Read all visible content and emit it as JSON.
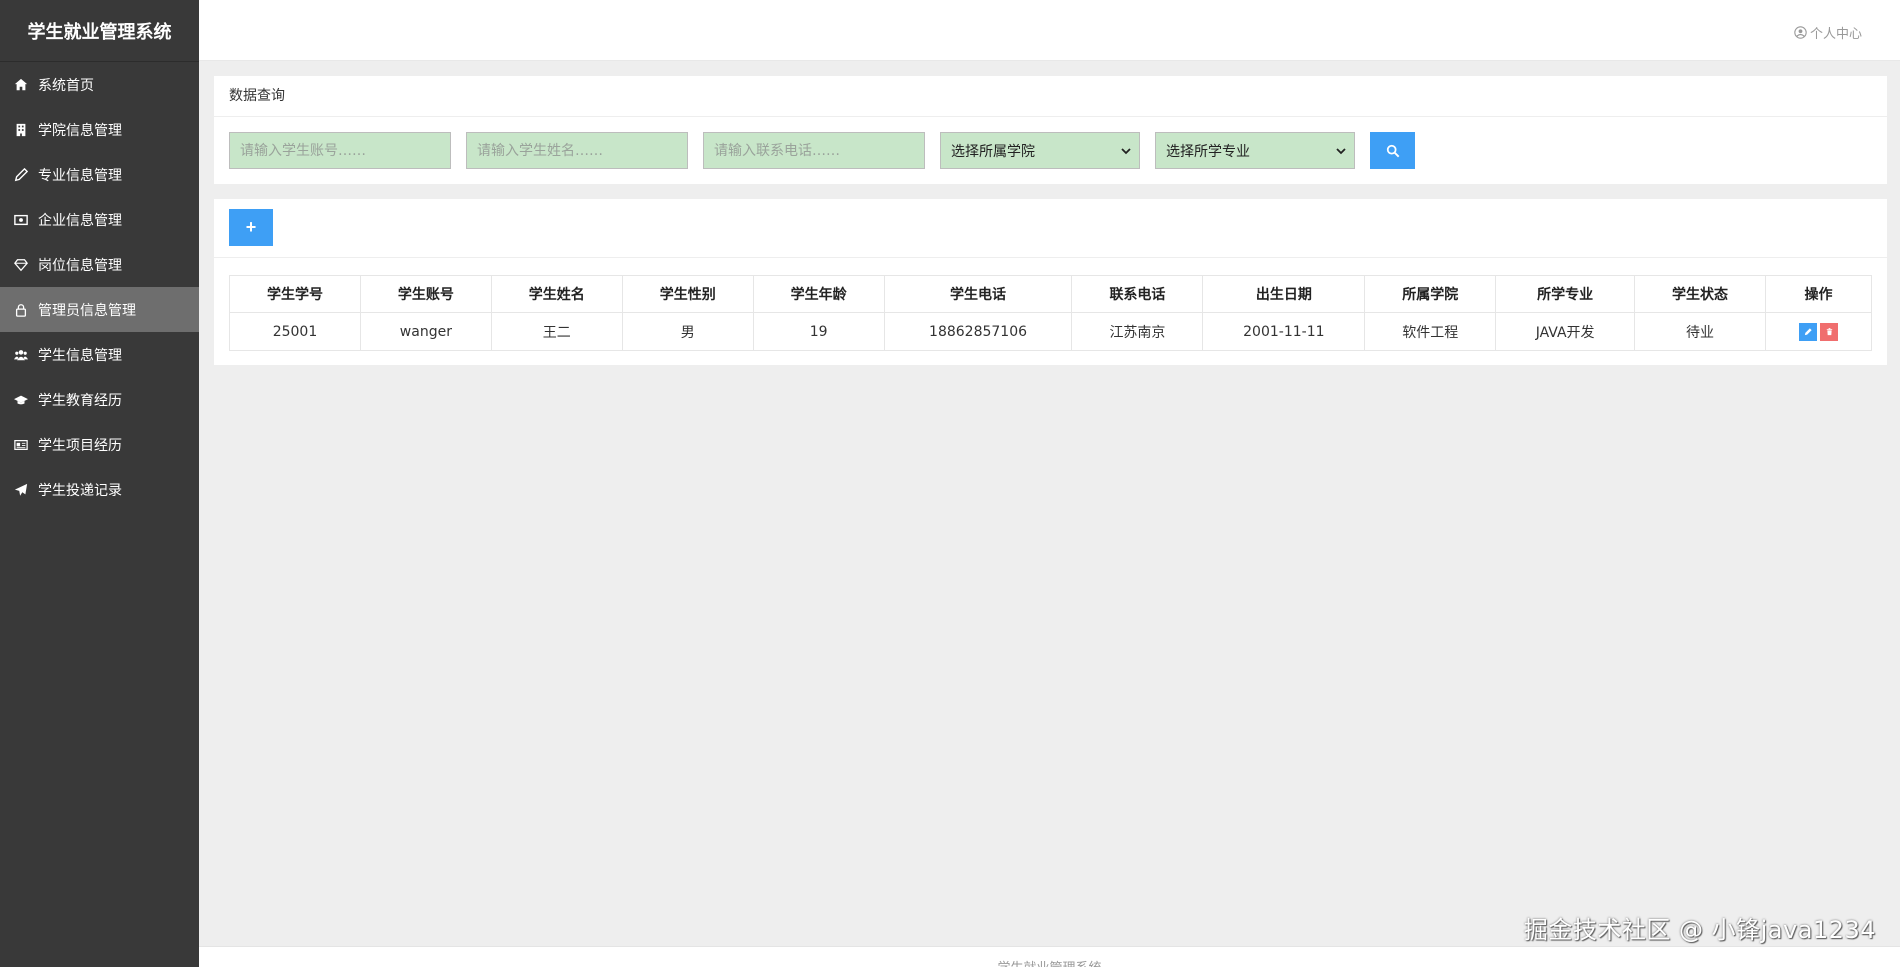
{
  "app": {
    "title": "学生就业管理系统"
  },
  "sidebar": {
    "items": [
      {
        "label": "系统首页",
        "icon": "home-icon"
      },
      {
        "label": "学院信息管理",
        "icon": "building-icon"
      },
      {
        "label": "专业信息管理",
        "icon": "pen-icon"
      },
      {
        "label": "企业信息管理",
        "icon": "money-icon"
      },
      {
        "label": "岗位信息管理",
        "icon": "diamond-icon"
      },
      {
        "label": "管理员信息管理",
        "icon": "lock-icon",
        "active": true
      },
      {
        "label": "学生信息管理",
        "icon": "users-icon"
      },
      {
        "label": "学生教育经历",
        "icon": "graduation-cap-icon"
      },
      {
        "label": "学生项目经历",
        "icon": "id-card-icon"
      },
      {
        "label": "学生投递记录",
        "icon": "paper-plane-icon"
      }
    ]
  },
  "header": {
    "user_center": "个人中心"
  },
  "search": {
    "title": "数据查询",
    "account_placeholder": "请输入学生账号……",
    "name_placeholder": "请输入学生姓名……",
    "phone_placeholder": "请输入联系电话……",
    "college_select": "选择所属学院",
    "major_select": "选择所学专业"
  },
  "toolbar": {
    "add_label": "+"
  },
  "table": {
    "headers": [
      "学生学号",
      "学生账号",
      "学生姓名",
      "学生性别",
      "学生年龄",
      "学生电话",
      "联系电话",
      "出生日期",
      "所属学院",
      "所学专业",
      "学生状态",
      "操作"
    ],
    "rows": [
      [
        "25001",
        "wanger",
        "王二",
        "男",
        "19",
        "18862857106",
        "江苏南京",
        "2001-11-11",
        "软件工程",
        "JAVA开发",
        "待业"
      ]
    ]
  },
  "footer": {
    "text": "学生就业管理系统"
  },
  "watermark": "掘金技术社区 @ 小锋java1234",
  "colors": {
    "sidebar_bg": "#393939",
    "active_item": "#6e6e6e",
    "primary_button": "#3e9ff5",
    "danger_button": "#f06e6e",
    "input_bg": "#c8e6c9"
  }
}
